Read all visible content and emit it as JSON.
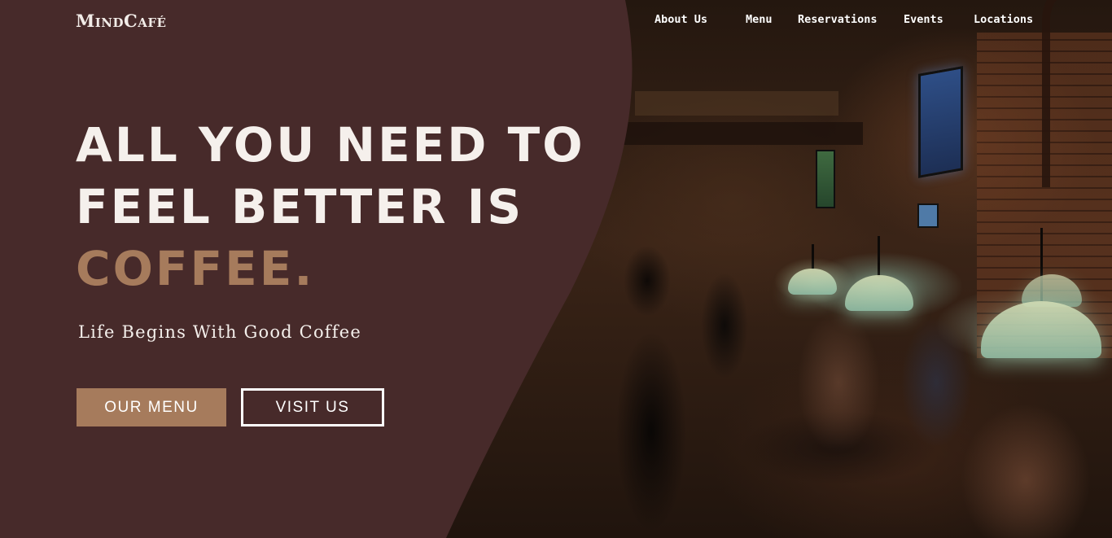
{
  "brand": {
    "logo_text": "MindCafé"
  },
  "nav": {
    "items": [
      {
        "label": "About Us"
      },
      {
        "label": "Menu"
      },
      {
        "label": "Reservations"
      },
      {
        "label": "Events"
      },
      {
        "label": "Locations"
      }
    ]
  },
  "hero": {
    "headline_lines": [
      "ALL YOU NEED TO",
      "FEEL BETTER IS"
    ],
    "headline_accent": "COFFEE.",
    "tagline": "Life Begins With Good Coffee",
    "buttons": {
      "primary_label": "OUR MENU",
      "secondary_label": "VISIT US"
    }
  },
  "colors": {
    "panel_brown": "#472a2a",
    "accent_tan": "#a67b5c",
    "text_light": "#f5f0ec"
  }
}
